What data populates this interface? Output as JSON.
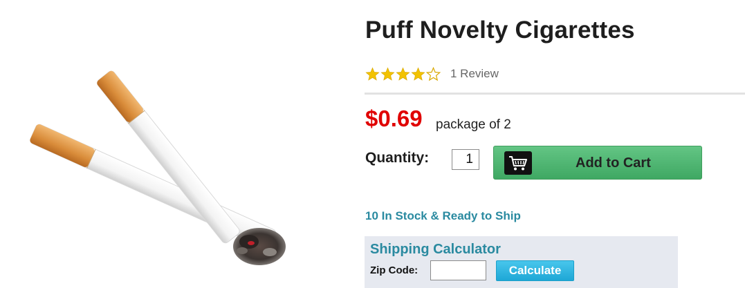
{
  "product": {
    "title": "Puff Novelty Cigarettes",
    "rating": 4,
    "rating_max": 5,
    "review_count_text": "1 Review",
    "price": "$0.69",
    "package": "package of 2",
    "image_alt": "product-image-two-cigarettes"
  },
  "purchase": {
    "quantity_label": "Quantity:",
    "quantity_value": "1",
    "add_to_cart_label": "Add to Cart",
    "add_to_cart_icon": "shopping-cart-icon",
    "stock_text": "10 In Stock & Ready to Ship"
  },
  "shipping": {
    "title": "Shipping Calculator",
    "zip_label": "Zip Code:",
    "zip_value": "",
    "calculate_label": "Calculate"
  },
  "colors": {
    "price": "#e00000",
    "star_filled": "#f2c200",
    "accent_teal": "#2a8aa0",
    "cart_button": "#4fb672",
    "calculate_button": "#2fb5e0"
  }
}
